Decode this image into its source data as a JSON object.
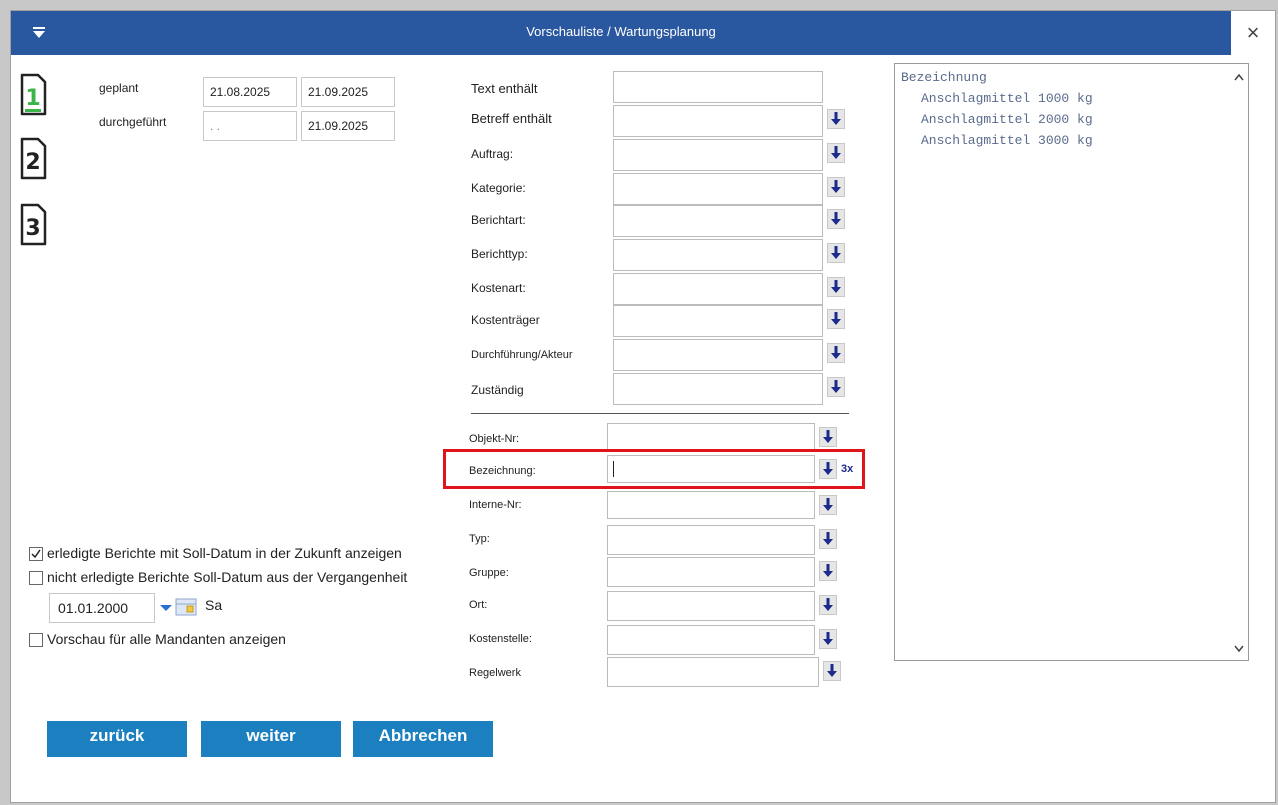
{
  "window": {
    "title": "Vorschauliste / Wartungsplanung",
    "close_glyph": "×"
  },
  "steps": [
    "1",
    "2",
    "3"
  ],
  "dates": {
    "geplant_label": "geplant",
    "durchgefuehrt_label": "durchgeführt",
    "geplant_from": "21.08.2025",
    "geplant_to": "21.09.2025",
    "durchgefuehrt_from": ". .",
    "durchgefuehrt_to": "21.09.2025"
  },
  "filters": {
    "text_contains": "Text enthält",
    "subject_contains": "Betreff enthält",
    "auftrag": "Auftrag:",
    "kategorie": "Kategorie:",
    "berichtart": "Berichtart:",
    "berichttyp": "Berichttyp:",
    "kostenart": "Kostenart:",
    "kostentraeger": "Kostenträger",
    "durchfuehrung": "Durchführung/Akteur",
    "zustaendig": "Zuständig"
  },
  "object_filters": {
    "objekt_nr": "Objekt-Nr:",
    "bezeichnung": "Bezeichnung:",
    "bezeichnung_count": "3x",
    "interne_nr": "Interne-Nr:",
    "typ": "Typ:",
    "gruppe": "Gruppe:",
    "ort": "Ort:",
    "kostenstelle": "Kostenstelle:",
    "regelwerk": "Regelwerk"
  },
  "options": {
    "future_done": "erledigte Berichte mit Soll-Datum in der Zukunft anzeigen",
    "past_open": "nicht erledigte Berichte Soll-Datum aus der Vergangenheit",
    "past_date": "01.01.2000",
    "past_day": "Sa",
    "all_clients": "Vorschau für alle Mandanten anzeigen",
    "future_done_checked": true,
    "past_open_checked": false,
    "all_clients_checked": false
  },
  "preview": {
    "header": "Bezeichnung",
    "items": [
      "Anschlagmittel 1000 kg",
      "Anschlagmittel 2000 kg",
      "Anschlagmittel 3000 kg"
    ]
  },
  "buttons": {
    "back": "zurück",
    "next": "weiter",
    "cancel": "Abbrechen"
  },
  "colors": {
    "titlebar": "#2957a0",
    "button": "#1b7fc0",
    "highlight": "#e0141b",
    "step_active": "#3bb54a"
  }
}
